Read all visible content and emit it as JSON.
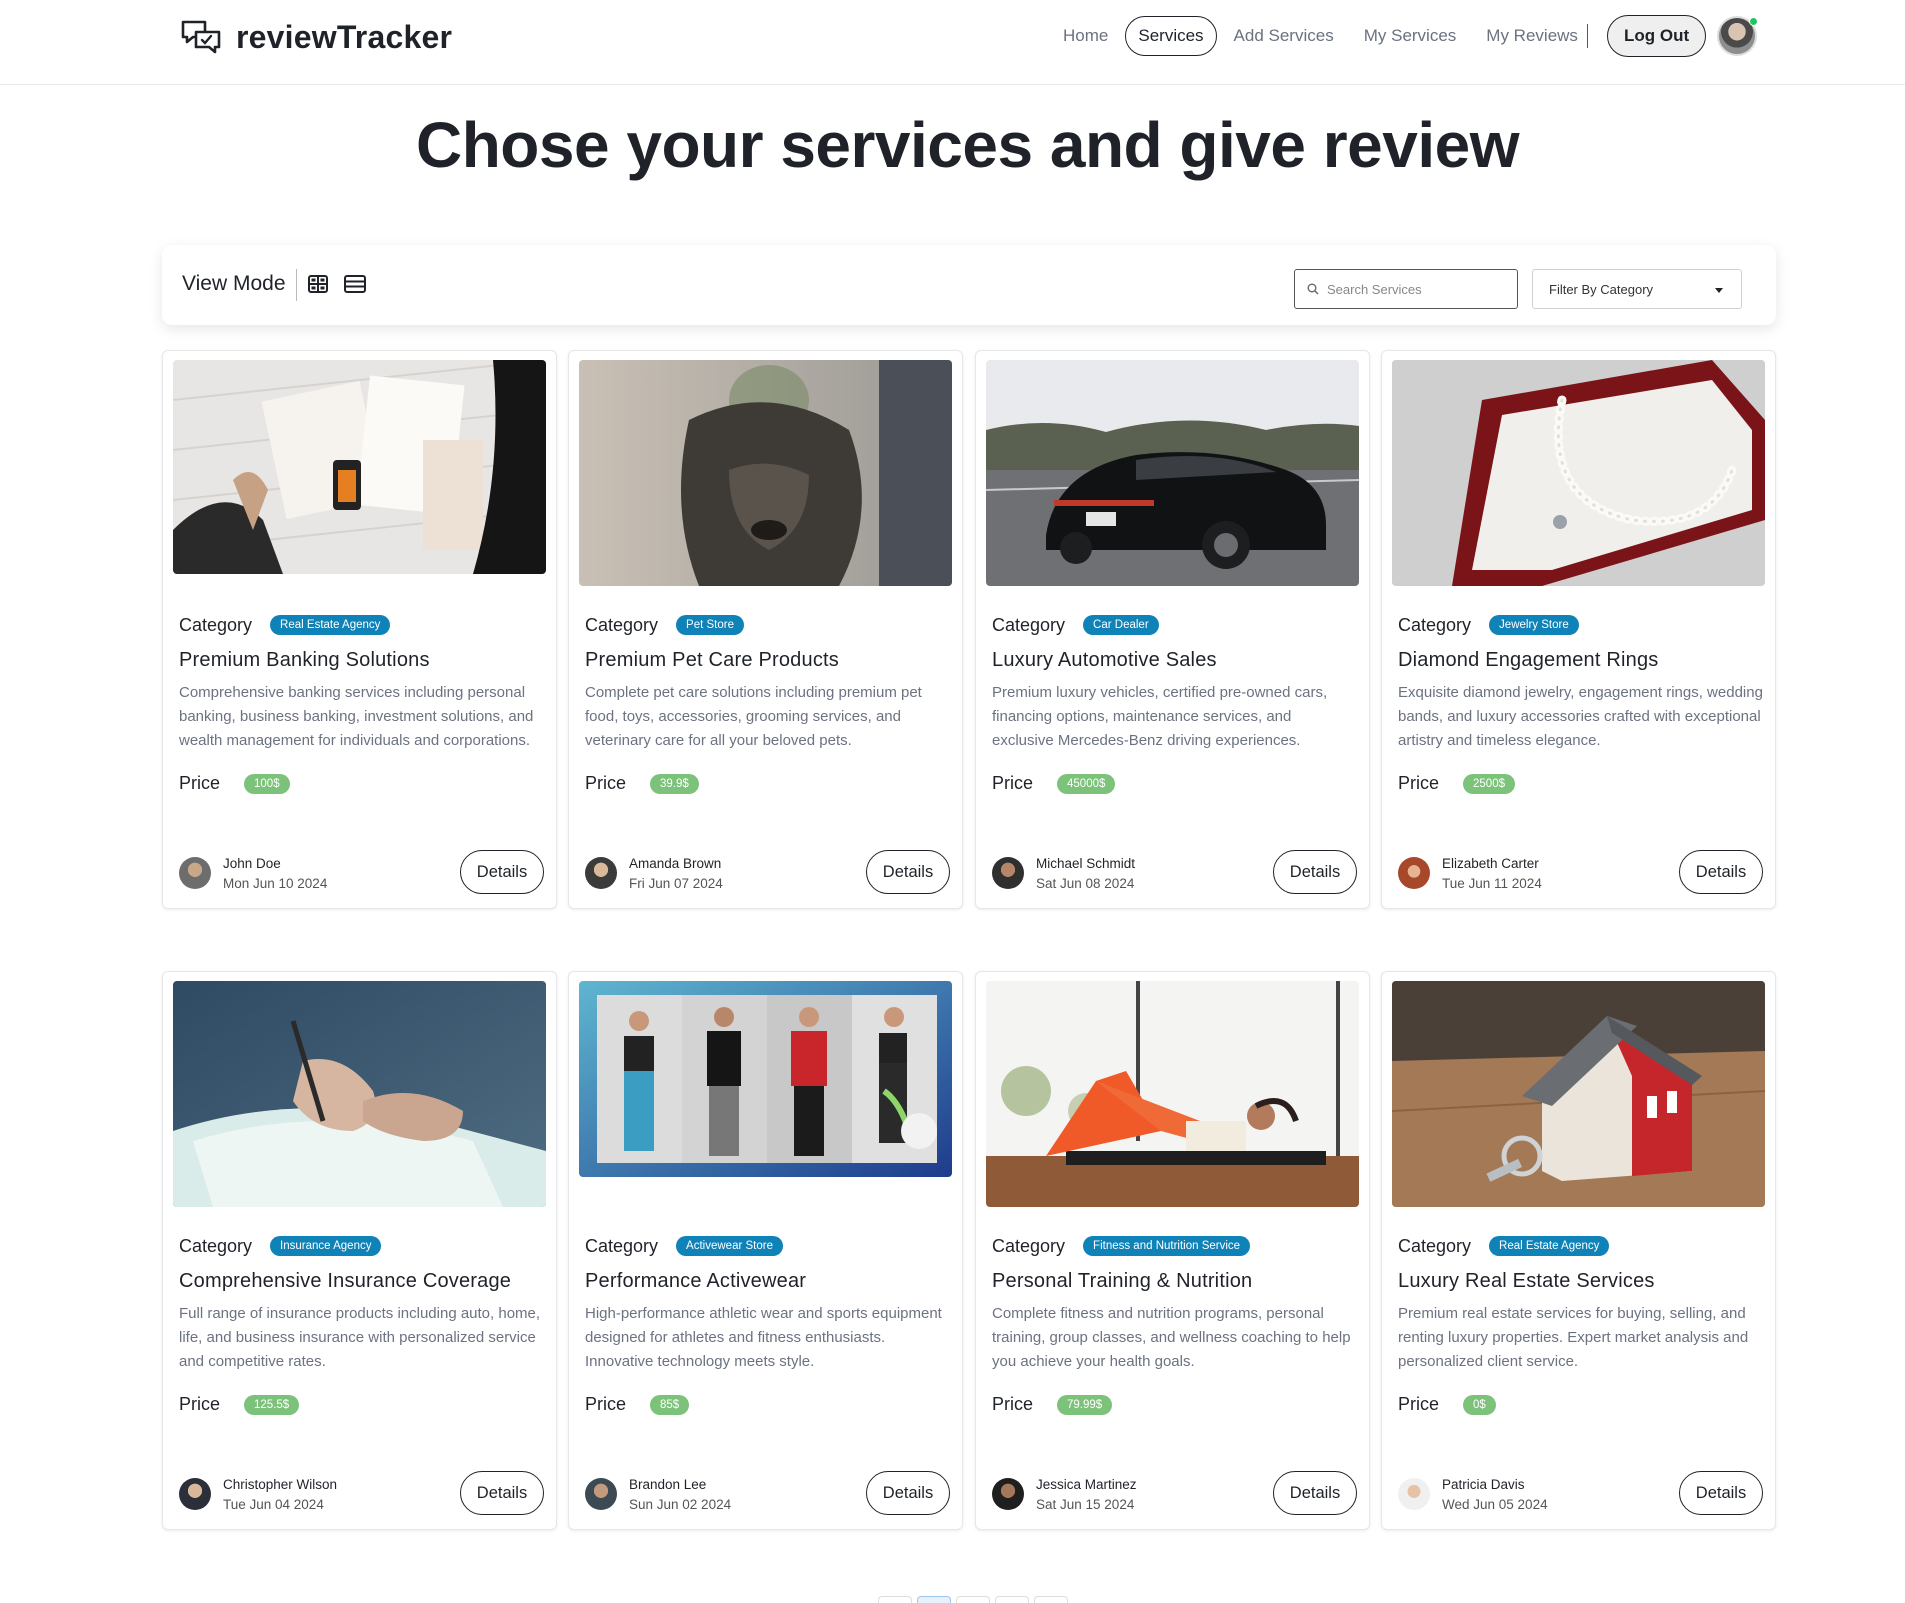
{
  "brand": {
    "name": "reviewTracker"
  },
  "nav": {
    "links": [
      "Home",
      "Services",
      "Add Services",
      "My Services",
      "My Reviews"
    ],
    "active": "Services",
    "logout_label": "Log Out"
  },
  "page": {
    "title": "Chose your services and give review"
  },
  "toolbar": {
    "view_mode_label": "View Mode",
    "search_placeholder": "Search Services",
    "filter_label": "Filter By Category"
  },
  "labels": {
    "category": "Category",
    "price": "Price",
    "details": "Details"
  },
  "colors": {
    "badge": "#0f82b8",
    "price_badge": "#7dc27a",
    "text": "#1f2329",
    "muted": "#6b7280"
  },
  "cards": [
    {
      "category": "Real Estate Agency",
      "title": "Premium Banking Solutions",
      "description": "Comprehensive banking services including personal banking, business banking, investment solutions, and wealth management for individuals and corporations.",
      "price": "100$",
      "author": "John Doe",
      "date": "Mon Jun 10 2024",
      "image": "finance-documents-photo"
    },
    {
      "category": "Pet Store",
      "title": "Premium Pet Care Products",
      "description": "Complete pet care solutions including premium pet food, toys, accessories, grooming services, and veterinary care for all your beloved pets.",
      "price": "39.9$",
      "author": "Amanda Brown",
      "date": "Fri Jun 07 2024",
      "image": "dog-photo"
    },
    {
      "category": "Car Dealer",
      "title": "Luxury Automotive Sales",
      "description": "Premium luxury vehicles, certified pre-owned cars, financing options, maintenance services, and exclusive Mercedes-Benz driving experiences.",
      "price": "45000$",
      "author": "Michael Schmidt",
      "date": "Sat Jun 08 2024",
      "image": "black-car-photo"
    },
    {
      "category": "Jewelry Store",
      "title": "Diamond Engagement Rings",
      "description": "Exquisite diamond jewelry, engagement rings, wedding bands, and luxury accessories crafted with exceptional artistry and timeless elegance.",
      "price": "2500$",
      "author": "Elizabeth Carter",
      "date": "Tue Jun 11 2024",
      "image": "pearl-necklace-photo"
    },
    {
      "category": "Insurance Agency",
      "title": "Comprehensive Insurance Coverage",
      "description": "Full range of insurance products including auto, home, life, and business insurance with personalized service and competitive rates.",
      "price": "125.5$",
      "author": "Christopher Wilson",
      "date": "Tue Jun 04 2024",
      "image": "signing-document-photo"
    },
    {
      "category": "Activewear Store",
      "title": "Performance Activewear",
      "description": "High-performance athletic wear and sports equipment designed for athletes and fitness enthusiasts. Innovative technology meets style.",
      "price": "85$",
      "author": "Brandon Lee",
      "date": "Sun Jun 02 2024",
      "image": "activewear-models-photo"
    },
    {
      "category": "Fitness and Nutrition Service",
      "title": "Personal Training & Nutrition",
      "description": "Complete fitness and nutrition programs, personal training, group classes, and wellness coaching to help you achieve your health goals.",
      "price": "79.99$",
      "author": "Jessica Martinez",
      "date": "Sat Jun 15 2024",
      "image": "workout-photo"
    },
    {
      "category": "Real Estate Agency",
      "title": "Luxury Real Estate Services",
      "description": "Premium real estate services for buying, selling, and renting luxury properties. Expert market analysis and personalized client service.",
      "price": "0$",
      "author": "Patricia Davis",
      "date": "Wed Jun 05 2024",
      "image": "house-model-photo"
    }
  ]
}
